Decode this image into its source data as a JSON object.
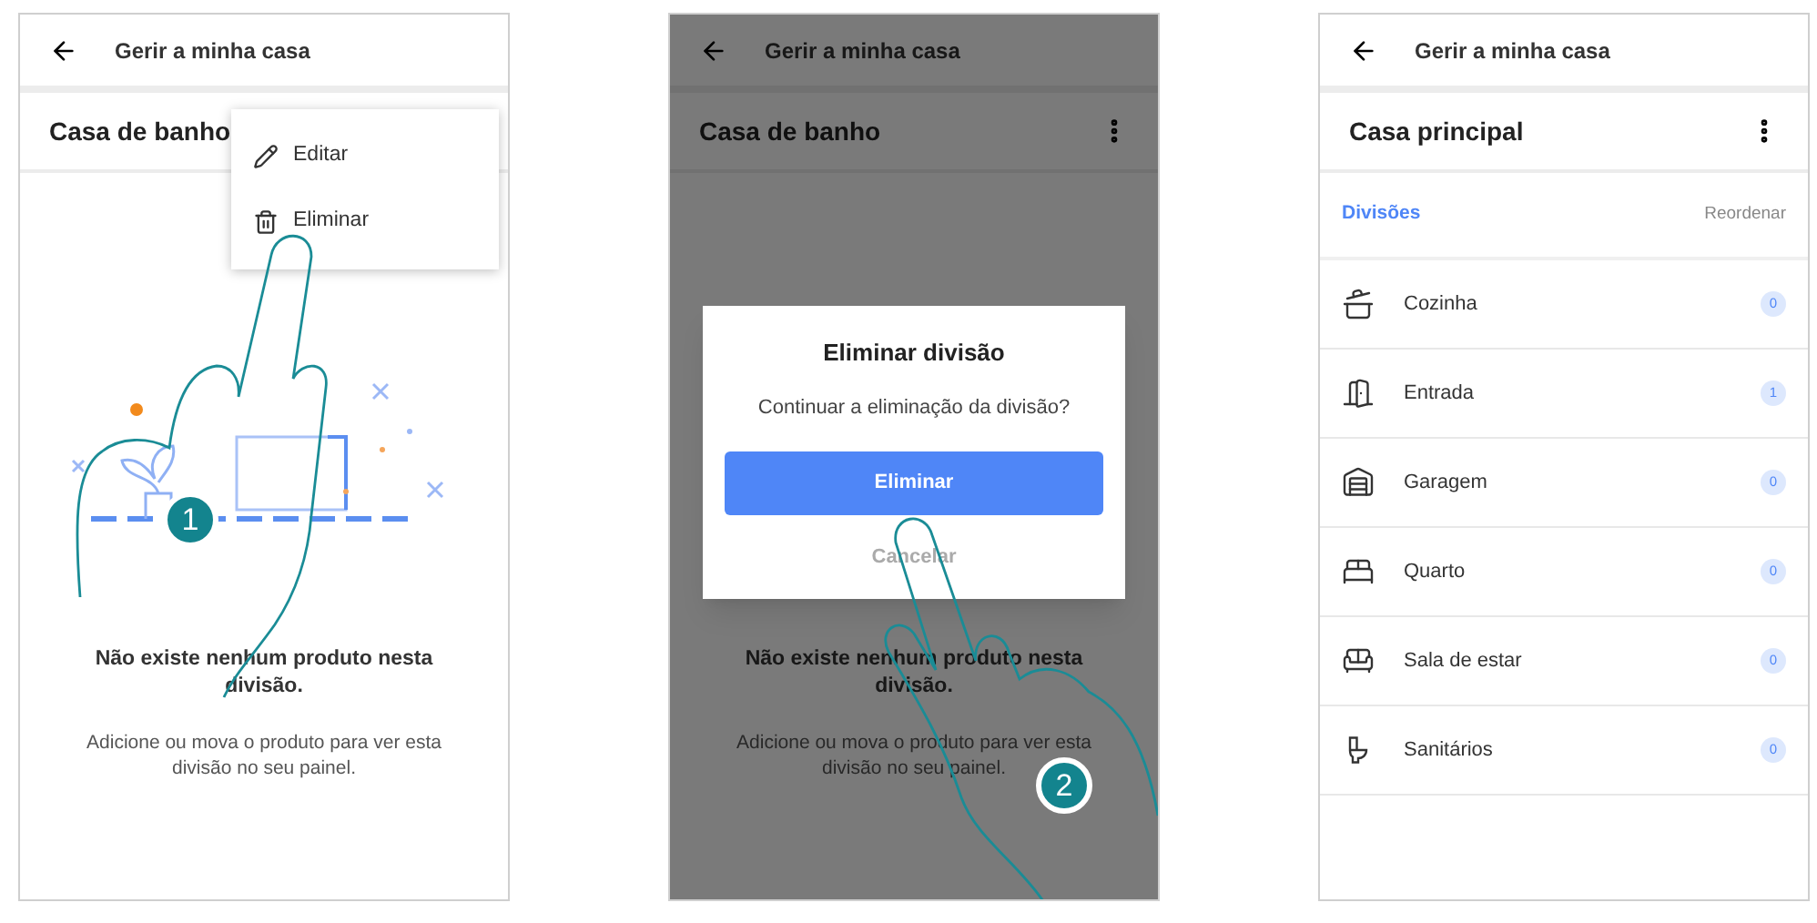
{
  "screens": [
    {
      "kind": "room_empty",
      "header": {
        "title": "Gerir a minha casa"
      },
      "room_title": "Casa de banho",
      "menu": {
        "items": [
          {
            "kind": "edit",
            "label": "Editar"
          },
          {
            "kind": "delete",
            "label": "Eliminar"
          }
        ]
      },
      "empty": {
        "heading": "Não existe nenhum produto nesta divisão.",
        "body": "Adicione ou mova o produto para ver esta divisão no seu painel."
      },
      "step": "1"
    },
    {
      "kind": "room_dialog",
      "header": {
        "title": "Gerir a minha casa"
      },
      "room_title": "Casa de banho",
      "empty": {
        "heading": "Não existe nenhum produto nesta divisão.",
        "body": "Adicione ou mova o produto para ver esta divisão no seu painel."
      },
      "dialog": {
        "title": "Eliminar divisão",
        "message": "Continuar a eliminação da divisão?",
        "confirm": "Eliminar",
        "cancel": "Cancelar"
      },
      "step": "2"
    },
    {
      "kind": "room_list",
      "header": {
        "title": "Gerir a minha casa"
      },
      "room_title": "Casa principal",
      "section": "Divisões",
      "action": "Reordenar",
      "rooms": [
        {
          "kind": "pot",
          "name": "Cozinha",
          "count": "0"
        },
        {
          "kind": "door",
          "name": "Entrada",
          "count": "1"
        },
        {
          "kind": "garage",
          "name": "Garagem",
          "count": "0"
        },
        {
          "kind": "bed",
          "name": "Quarto",
          "count": "0"
        },
        {
          "kind": "sofa",
          "name": "Sala de estar",
          "count": "0"
        },
        {
          "kind": "toilet",
          "name": "Sanitários",
          "count": "0"
        }
      ]
    }
  ]
}
